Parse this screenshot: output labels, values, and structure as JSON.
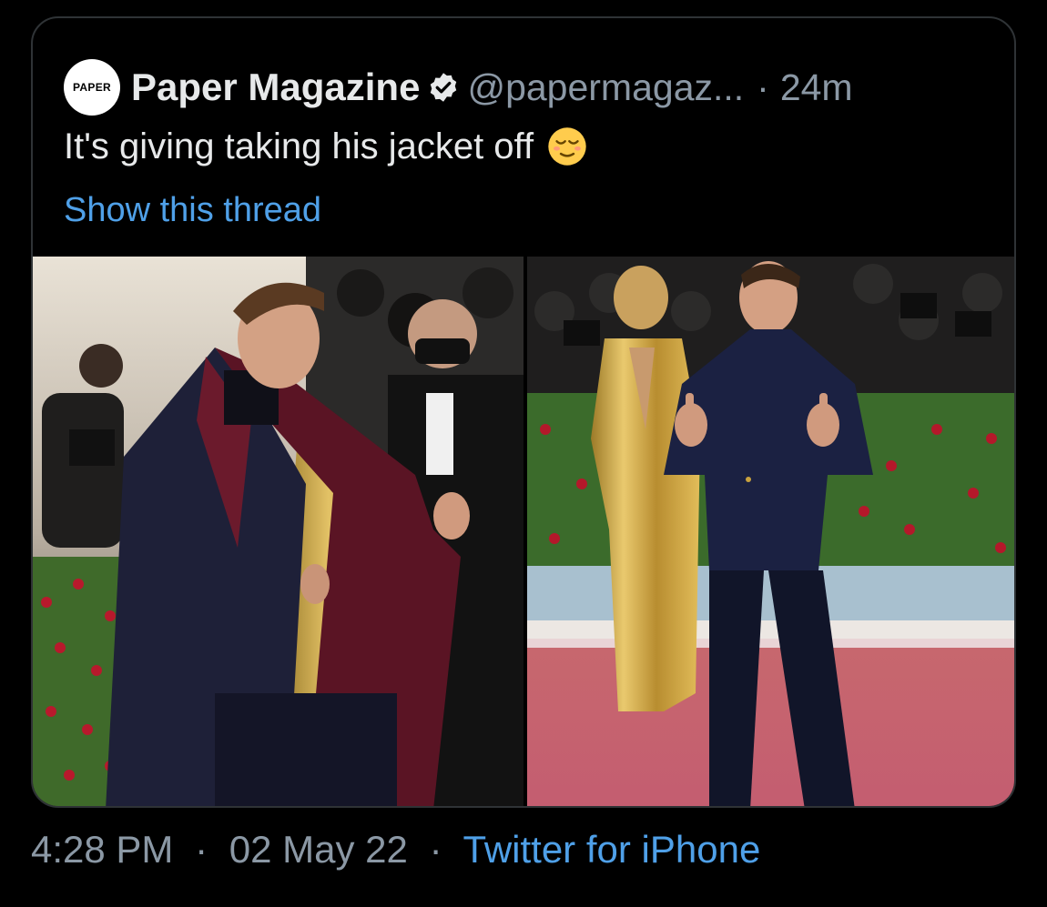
{
  "tweet": {
    "avatar_text": "PAPER",
    "author_name": "Paper Magazine",
    "handle": "@papermagaz...",
    "separator": "·",
    "age": "24m",
    "text": "It's giving taking his jacket off",
    "show_thread": "Show this thread",
    "media": [
      {
        "description": "photo-left"
      },
      {
        "description": "photo-right"
      }
    ]
  },
  "footer": {
    "time": "4:28 PM",
    "sep1": "·",
    "date": "02 May 22",
    "sep2": "·",
    "source": "Twitter for iPhone"
  },
  "colors": {
    "background": "#000000",
    "text": "#e7e9ea",
    "muted": "#8b98a5",
    "link": "#4fa0e8",
    "border": "#2f3336"
  }
}
